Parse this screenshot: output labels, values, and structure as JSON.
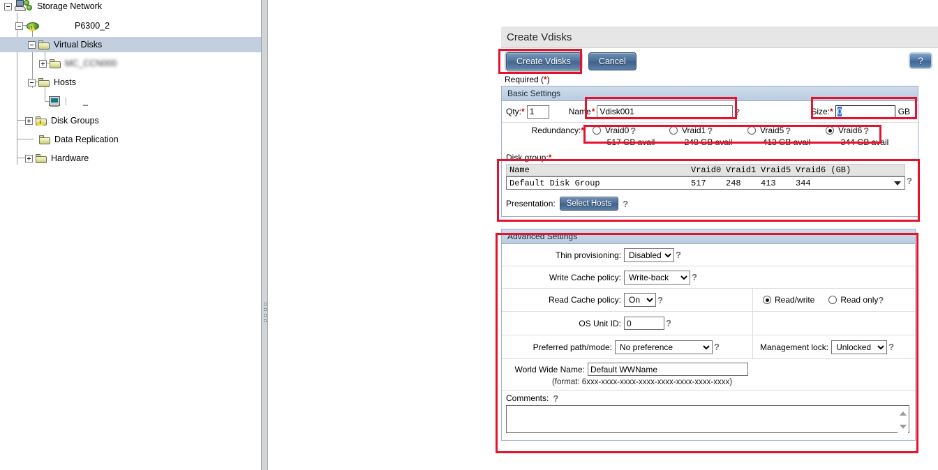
{
  "sidebar": {
    "tree": [
      {
        "label": "Storage Network",
        "icon": "storage-network-icon",
        "twisty": "minus",
        "depth": 0,
        "selected": false,
        "redacted": false
      },
      {
        "label": "P6300_2",
        "icon": "array-icon",
        "twisty": "minus",
        "depth": 1,
        "selected": false,
        "redacted": false
      },
      {
        "label": "Virtual Disks",
        "icon": "folder-icon",
        "twisty": "minus",
        "depth": 2,
        "selected": true,
        "redacted": false
      },
      {
        "label": "MC_CCN000",
        "icon": "folder-icon",
        "twisty": "plus",
        "depth": 3,
        "selected": false,
        "redacted": true
      },
      {
        "label": "Hosts",
        "icon": "folder-icon",
        "twisty": "minus",
        "depth": 2,
        "selected": false,
        "redacted": false
      },
      {
        "label": "_",
        "icon": "host-icon",
        "twisty": "none",
        "depth": 3,
        "selected": false,
        "redacted": false
      },
      {
        "label": "Disk Groups",
        "icon": "folder-warning-icon",
        "twisty": "plus",
        "depth": 2,
        "selected": false,
        "redacted": false
      },
      {
        "label": "Data Replication",
        "icon": "folder-icon",
        "twisty": "none",
        "depth": 2,
        "selected": false,
        "redacted": false
      },
      {
        "label": "Hardware",
        "icon": "folder-icon",
        "twisty": "plus",
        "depth": 2,
        "selected": false,
        "redacted": false
      }
    ]
  },
  "dialog": {
    "title": "Create Vdisks",
    "buttons": {
      "create": "Create Vdisks",
      "cancel": "Cancel",
      "help": "?"
    },
    "required_note_prefix": "Required (",
    "required_star": "*",
    "required_note_suffix": ")",
    "basic": {
      "header": "Basic Settings",
      "qty_label": "Qty:",
      "qty_value": "1",
      "name_label": "Name",
      "name_value": "Vdisk001",
      "size_label": "Size:",
      "size_value": "0",
      "size_unit": "GB",
      "redundancy_label": "Redundancy:",
      "redundancy_options": [
        {
          "label": "Vraid0",
          "avail": "517 GB avail",
          "selected": false
        },
        {
          "label": "Vraid1",
          "avail": "248 GB avail",
          "selected": false
        },
        {
          "label": "Vraid5",
          "avail": "413 GB avail",
          "selected": false
        },
        {
          "label": "Vraid6",
          "avail": "344 GB avail",
          "selected": true
        }
      ],
      "disk_group_label": "Disk group:",
      "disk_group_columns": [
        "Name",
        "Vraid0",
        "Vraid1",
        "Vraid5",
        "Vraid6 (GB)"
      ],
      "disk_group_row": {
        "name": "Default Disk Group",
        "vraid0": "517",
        "vraid1": "248",
        "vraid5": "413",
        "vraid6": "344"
      },
      "presentation_label": "Presentation:",
      "presentation_button": "Select Hosts"
    },
    "advanced": {
      "header": "Advanced Settings",
      "thin_label": "Thin provisioning:",
      "thin_value": "Disabled",
      "write_cache_label": "Write Cache policy:",
      "write_cache_value": "Write-back",
      "read_cache_label": "Read Cache policy:",
      "read_cache_value": "On",
      "access_options": [
        {
          "label": "Read/write",
          "selected": true
        },
        {
          "label": "Read only",
          "selected": false
        }
      ],
      "os_unit_label": "OS Unit ID:",
      "os_unit_value": "0",
      "pref_path_label": "Preferred path/mode:",
      "pref_path_value": "No preference",
      "mgmt_lock_label": "Management lock:",
      "mgmt_lock_value": "Unlocked",
      "wwn_label": "World Wide Name:",
      "wwn_value": "Default WWName",
      "wwn_format": "(format: 6xxx-xxxx-xxxx-xxxx-xxxx-xxxx-xxxx-xxxx)",
      "comments_label": "Comments:",
      "comments_value": ""
    }
  },
  "colors": {
    "highlight": "#e8112d",
    "panel_header": "#b9cce0",
    "selection": "#c3cfdf",
    "button": "#4a6d95"
  }
}
